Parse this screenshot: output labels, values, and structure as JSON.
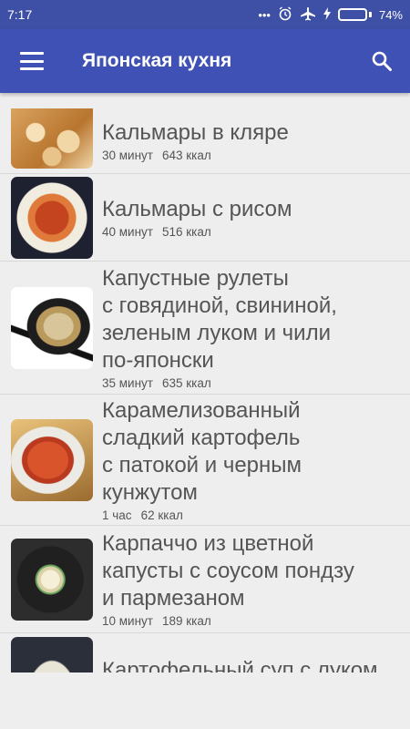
{
  "status_bar": {
    "time": "7:17",
    "battery_percent": "74%",
    "battery_level": 0.74
  },
  "app_bar": {
    "title": "Японская кухня",
    "menu_icon": "hamburger-menu-icon",
    "search_icon": "search-icon"
  },
  "colors": {
    "primary": "#3f51b5",
    "status": "#3e50a6",
    "background": "#eeeeee",
    "text": "#555555"
  },
  "recipes": [
    {
      "name": "Кальмары в кляре",
      "time": "30 минут",
      "calories": "643 ккал"
    },
    {
      "name": "Кальмары с рисом",
      "time": "40 минут",
      "calories": "516 ккал"
    },
    {
      "name": "Капустные рулеты\nс говядиной, свининой,\nзеленым луком и чили\nпо-японски",
      "time": "35 минут",
      "calories": "635 ккал"
    },
    {
      "name": "Карамелизованный\nсладкий картофель\nс патокой и черным\nкунжутом",
      "time": "1 час",
      "calories": "62 ккал"
    },
    {
      "name": "Карпаччо из цветной\nкапусты с соусом пондзу\nи пармезаном",
      "time": "10 минут",
      "calories": "189 ккал"
    },
    {
      "name": "Картофельный суп с луком",
      "time": "",
      "calories": ""
    }
  ]
}
